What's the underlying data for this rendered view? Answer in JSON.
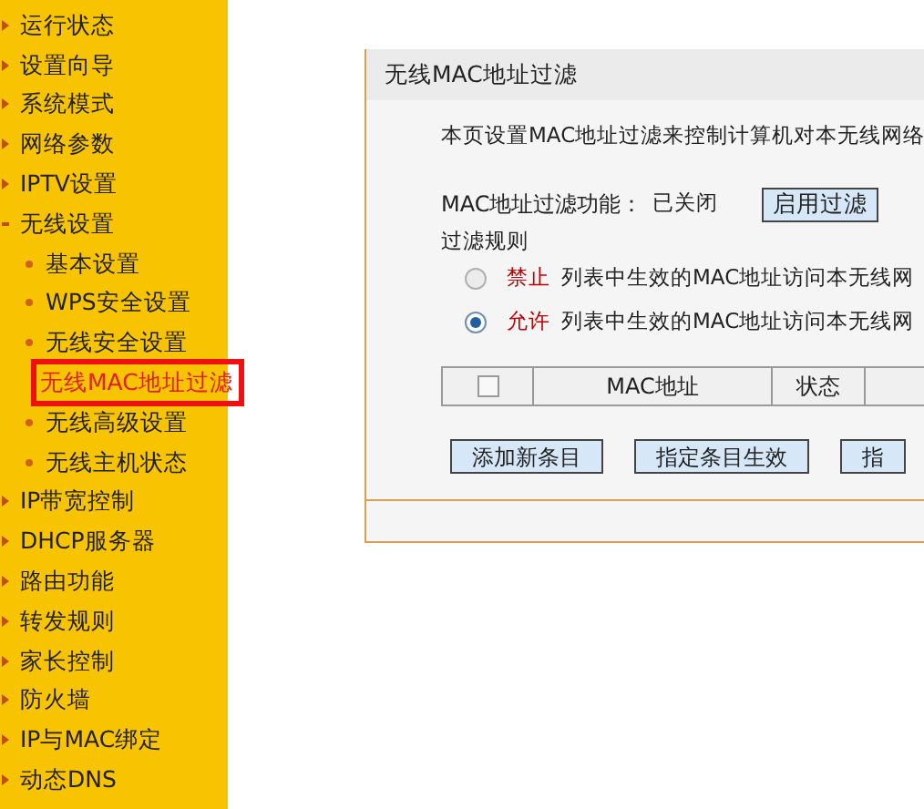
{
  "sidebar": {
    "items": [
      {
        "label": "运行状态",
        "selected": false
      },
      {
        "label": "设置向导",
        "selected": false
      },
      {
        "label": "系统模式",
        "selected": false
      },
      {
        "label": "网络参数",
        "selected": false
      },
      {
        "label": "IPTV设置",
        "selected": false
      },
      {
        "label": "无线设置",
        "selected": false,
        "expanded": true,
        "children": [
          {
            "label": "基本设置",
            "selected": false
          },
          {
            "label": "WPS安全设置",
            "selected": false
          },
          {
            "label": "无线安全设置",
            "selected": false
          },
          {
            "label": "无线MAC地址过滤",
            "selected": true
          },
          {
            "label": "无线高级设置",
            "selected": false
          },
          {
            "label": "无线主机状态",
            "selected": false
          }
        ]
      },
      {
        "label": "IP带宽控制",
        "selected": false
      },
      {
        "label": "DHCP服务器",
        "selected": false
      },
      {
        "label": "路由功能",
        "selected": false
      },
      {
        "label": "转发规则",
        "selected": false
      },
      {
        "label": "家长控制",
        "selected": false
      },
      {
        "label": "防火墙",
        "selected": false
      },
      {
        "label": "IP与MAC绑定",
        "selected": false
      },
      {
        "label": "动态DNS",
        "selected": false
      }
    ]
  },
  "panel": {
    "title": "无线MAC地址过滤",
    "description": "本页设置MAC地址过滤来控制计算机对本无线网络",
    "function_label": "MAC地址过滤功能：",
    "function_status": "已关闭",
    "function_button": "启用过滤",
    "rules_label": "过滤规则",
    "rules": [
      {
        "action": "禁止",
        "text": "列表中生效的MAC地址访问本无线网",
        "selected": false
      },
      {
        "action": "允许",
        "text": "列表中生效的MAC地址访问本无线网",
        "selected": true
      }
    ],
    "table": {
      "select_all_checked": false,
      "columns": [
        "MAC地址",
        "状态"
      ]
    },
    "buttons": [
      "添加新条目",
      "指定条目生效",
      "指"
    ]
  }
}
